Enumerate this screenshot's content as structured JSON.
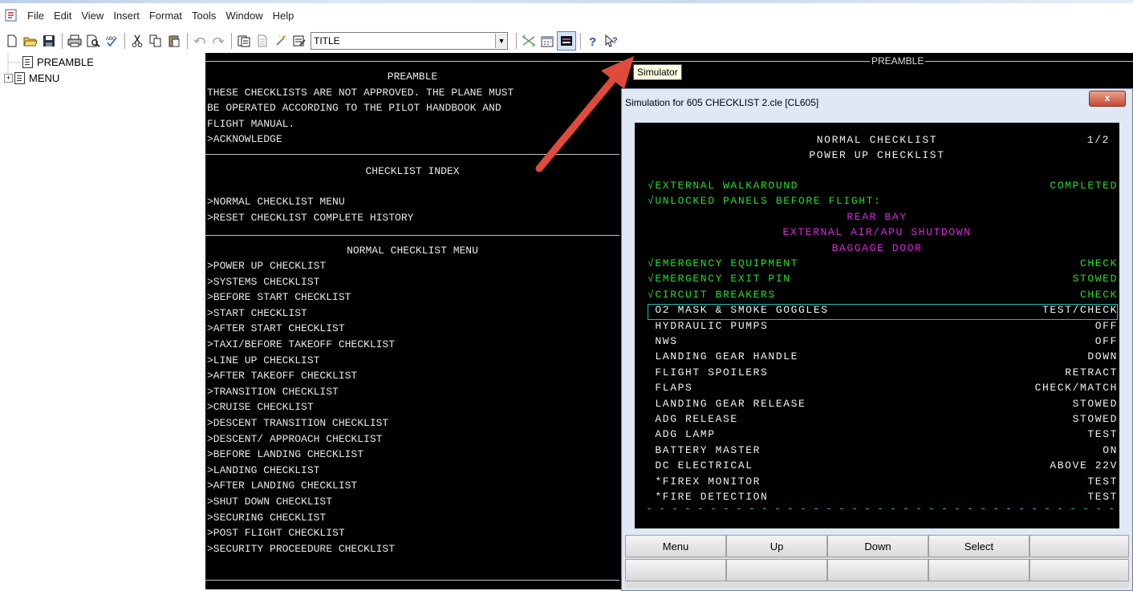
{
  "menubar": {
    "items": [
      "File",
      "Edit",
      "View",
      "Insert",
      "Format",
      "Tools",
      "Window",
      "Help"
    ]
  },
  "toolbar": {
    "style_value": "TITLE",
    "icons": [
      "new-icon",
      "open-icon",
      "save-icon",
      "print-icon",
      "print-preview-icon",
      "spell-check-icon",
      "cut-icon",
      "copy-icon",
      "paste-icon",
      "undo-icon",
      "redo-icon",
      "insert-page-icon",
      "document-icon",
      "magic-icon",
      "properties-icon",
      "simulator-link-icon",
      "calendar-icon",
      "simulator-icon",
      "help-icon",
      "context-help-icon"
    ]
  },
  "tree": {
    "items": [
      {
        "label": "PREAMBLE",
        "expander": ""
      },
      {
        "label": "MENU",
        "expander": "+"
      }
    ]
  },
  "editor": {
    "preamble_heading": "PREAMBLE",
    "preamble_lines": [
      "THESE CHECKLISTS ARE NOT APPROVED. THE PLANE MUST",
      "BE OPERATED ACCORDING TO THE PILOT HANDBOOK AND",
      "FLIGHT MANUAL.",
      ">ACKNOWLEDGE"
    ],
    "index_heading": "CHECKLIST INDEX",
    "index_lines": [
      ">NORMAL CHECKLIST MENU",
      ">RESET CHECKLIST COMPLETE HISTORY"
    ],
    "menu_heading": "NORMAL CHECKLIST MENU",
    "menu_lines": [
      ">POWER UP CHECKLIST",
      ">SYSTEMS CHECKLIST",
      ">BEFORE START CHECKLIST",
      ">START CHECKLIST",
      ">AFTER START CHECKLIST",
      ">TAXI/BEFORE TAKEOFF CHECKLIST",
      ">LINE UP CHECKLIST",
      ">AFTER TAKEOFF CHECKLIST",
      ">TRANSITION CHECKLIST",
      ">CRUISE CHECKLIST",
      ">DESCENT TRANSITION CHECKLIST",
      ">DESCENT/ APPROACH CHECKLIST",
      ">BEFORE LANDING CHECKLIST",
      ">LANDING CHECKLIST",
      ">AFTER LANDING CHECKLIST",
      ">SHUT DOWN CHECKLIST",
      ">SECURING CHECKLIST",
      ">POST FLIGHT CHECKLIST",
      ">SECURITY PROCEEDURE CHECKLIST"
    ]
  },
  "right_panel": {
    "heading": "PREAMBLE"
  },
  "tooltip": "Simulator",
  "simulation": {
    "title": "Simulation for 605 CHECKLIST 2.cle [CL605]",
    "close_label": "x",
    "header1": "NORMAL CHECKLIST",
    "page": "1/2",
    "header2": "POWER UP CHECKLIST",
    "rows": [
      {
        "item": "√EXTERNAL WALKAROUND",
        "value": "COMPLETED",
        "color": "g"
      },
      {
        "item": "√UNLOCKED PANELS BEFORE FLIGHT:",
        "value": "",
        "color": "g"
      },
      {
        "center": "REAR BAY",
        "color": "m"
      },
      {
        "center": "EXTERNAL AIR/APU SHUTDOWN",
        "color": "m"
      },
      {
        "center": "BAGGAGE DOOR",
        "color": "m"
      },
      {
        "item": "√EMERGENCY EQUIPMENT",
        "value": "CHECK",
        "color": "g"
      },
      {
        "item": "√EMERGENCY EXIT PIN",
        "value": "STOWED",
        "color": "g"
      },
      {
        "item": "√CIRCUIT BREAKERS",
        "value": "CHECK",
        "color": "g"
      },
      {
        "item": " O2 MASK & SMOKE GOGGLES",
        "value": "TEST/CHECK",
        "color": "w"
      },
      {
        "item": " HYDRAULIC PUMPS",
        "value": "OFF",
        "color": "w"
      },
      {
        "item": " NWS",
        "value": "OFF",
        "color": "w"
      },
      {
        "item": " LANDING GEAR HANDLE",
        "value": "DOWN",
        "color": "w"
      },
      {
        "item": " FLIGHT SPOILERS",
        "value": "RETRACT",
        "color": "w"
      },
      {
        "item": " FLAPS",
        "value": "CHECK/MATCH",
        "color": "w"
      },
      {
        "item": " LANDING GEAR RELEASE",
        "value": "STOWED",
        "color": "w"
      },
      {
        "item": " ADG RELEASE",
        "value": "STOWED",
        "color": "w"
      },
      {
        "item": " ADG LAMP",
        "value": "TEST",
        "color": "w"
      },
      {
        "item": " BATTERY MASTER",
        "value": "ON",
        "color": "w"
      },
      {
        "item": " DC ELECTRICAL",
        "value": "ABOVE 22V",
        "color": "w"
      },
      {
        "item": " *FIREX MONITOR",
        "value": "TEST",
        "color": "w"
      },
      {
        "item": " *FIRE DETECTION",
        "value": "TEST",
        "color": "w"
      }
    ],
    "buttons": [
      "Menu",
      "Up",
      "Down",
      "Select",
      ""
    ]
  },
  "colors": {
    "green": "#22dd22",
    "magenta": "#e020e0",
    "cyan": "#22bbbb",
    "arrow": "#e04a3a"
  }
}
